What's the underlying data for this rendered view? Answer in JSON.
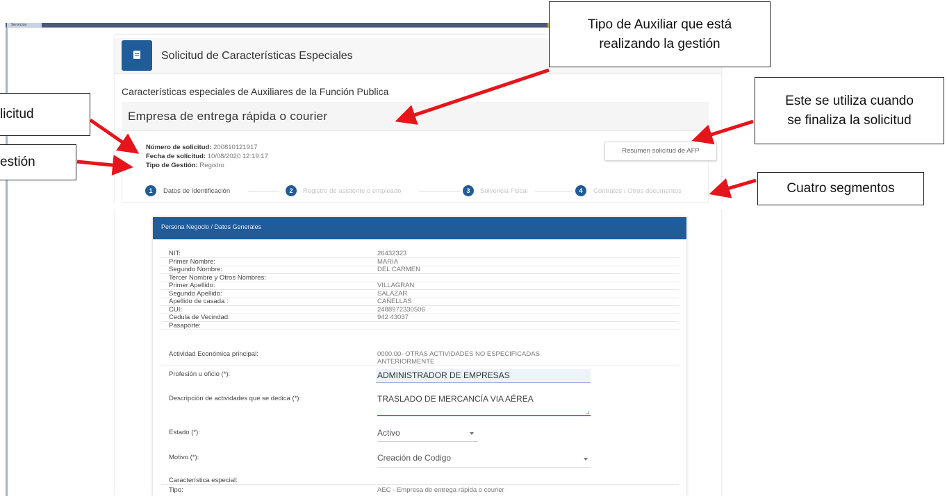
{
  "window": {
    "tab_label": "Servicios"
  },
  "header": {
    "title": "Solicitud de Características Especiales",
    "icon": "document-icon"
  },
  "section_title": "Características especiales de Auxiliares de la Función Publica",
  "auxiliary_type": "Empresa de entrega rápida o courier",
  "request_info": {
    "numero_label": "Número de solicitud:",
    "numero_value": "200810121917",
    "fecha_label": "Fecha de solicitud:",
    "fecha_value": "10/08/2020 12:19:17",
    "tipo_label": "Tipo de Gestión:",
    "tipo_value": "Registro"
  },
  "resumen_button": "Resumen solicitud de AFP",
  "steps": [
    {
      "number": "1",
      "label": "Datos de Identificación",
      "active": true
    },
    {
      "number": "2",
      "label": "Registro de asistente o empleado",
      "active": false
    },
    {
      "number": "3",
      "label": "Solvencia Fiscal",
      "active": false
    },
    {
      "number": "4",
      "label": "Contratos / Otros documentos",
      "active": false
    }
  ],
  "form": {
    "header": "Persona Negocio / Datos Generales",
    "rows": [
      {
        "label": "NIT:",
        "value": "26432323"
      },
      {
        "label": "Primer Nombre:",
        "value": "MARIA"
      },
      {
        "label": "Segundo Nombre:",
        "value": "DEL CARMEN"
      },
      {
        "label": "Tercer Nombre y Otros Nombres:",
        "value": ""
      },
      {
        "label": "Primer Apellido:",
        "value": "VILLAGRAN"
      },
      {
        "label": "Segundo Apellido:",
        "value": "SALAZAR"
      },
      {
        "label": "Apellido de casada :",
        "value": "CAÑELLAS"
      },
      {
        "label": "CUI:",
        "value": "2488972330506"
      },
      {
        "label": "Cedula de Vecindad:",
        "value": "942 43037"
      },
      {
        "label": "Pasaporte:",
        "value": ""
      }
    ],
    "actividad_label": "Actividad Económica principal:",
    "actividad_value_1": "0000.00- OTRAS ACTIVIDADES NO ESPECIFICADAS",
    "actividad_value_2": "ANTERIORMENTE",
    "profesion_label": "Profesión u oficio (*):",
    "profesion_value": "ADMINISTRADOR DE EMPRESAS",
    "descripcion_label": "Descripción de actividades que se dedica (*):",
    "descripcion_value": "TRASLADO DE MERCANCÍA VIA AÉREA",
    "estado_label": "Estado (*):",
    "estado_value": "Activo",
    "motivo_label": "Motivo (*):",
    "motivo_value": "Creación de Codigo",
    "caracteristica_label": "Característica especial:",
    "tipo_label": "Tipo:",
    "tipo_value": "AEC - Empresa de entrega rápida o courier"
  },
  "callouts": {
    "tipo_auxiliar_1": "Tipo de Auxiliar que está",
    "tipo_auxiliar_2": "realizando la gestión",
    "finaliza_1": "Este se utiliza cuando",
    "finaliza_2": "se finaliza la solicitud",
    "segmentos": "Cuatro segmentos",
    "solicitud": "licitud",
    "gestion": "estión"
  },
  "colors": {
    "brand_blue": "#1f5c99",
    "annotation_red": "#e8141b"
  }
}
